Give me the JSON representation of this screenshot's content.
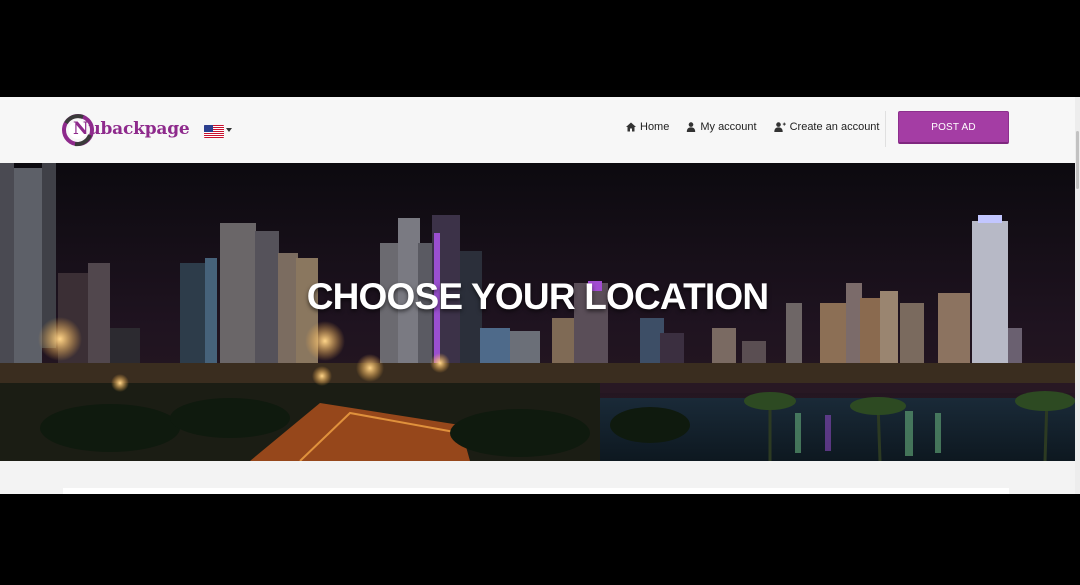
{
  "brand": {
    "logo_text": "Nubackpage",
    "color": "#8e2a8c"
  },
  "header": {
    "country_flag": "us-flag-icon",
    "nav": [
      {
        "label": "Home",
        "icon": "home-icon"
      },
      {
        "label": "My account",
        "icon": "user-icon"
      },
      {
        "label": "Create an account",
        "icon": "user-plus-icon"
      }
    ],
    "post_ad_label": "POST AD",
    "post_ad_color": "#a43da4"
  },
  "hero": {
    "title": "CHOOSE YOUR LOCATION",
    "background": "night-city-skyline-image"
  }
}
